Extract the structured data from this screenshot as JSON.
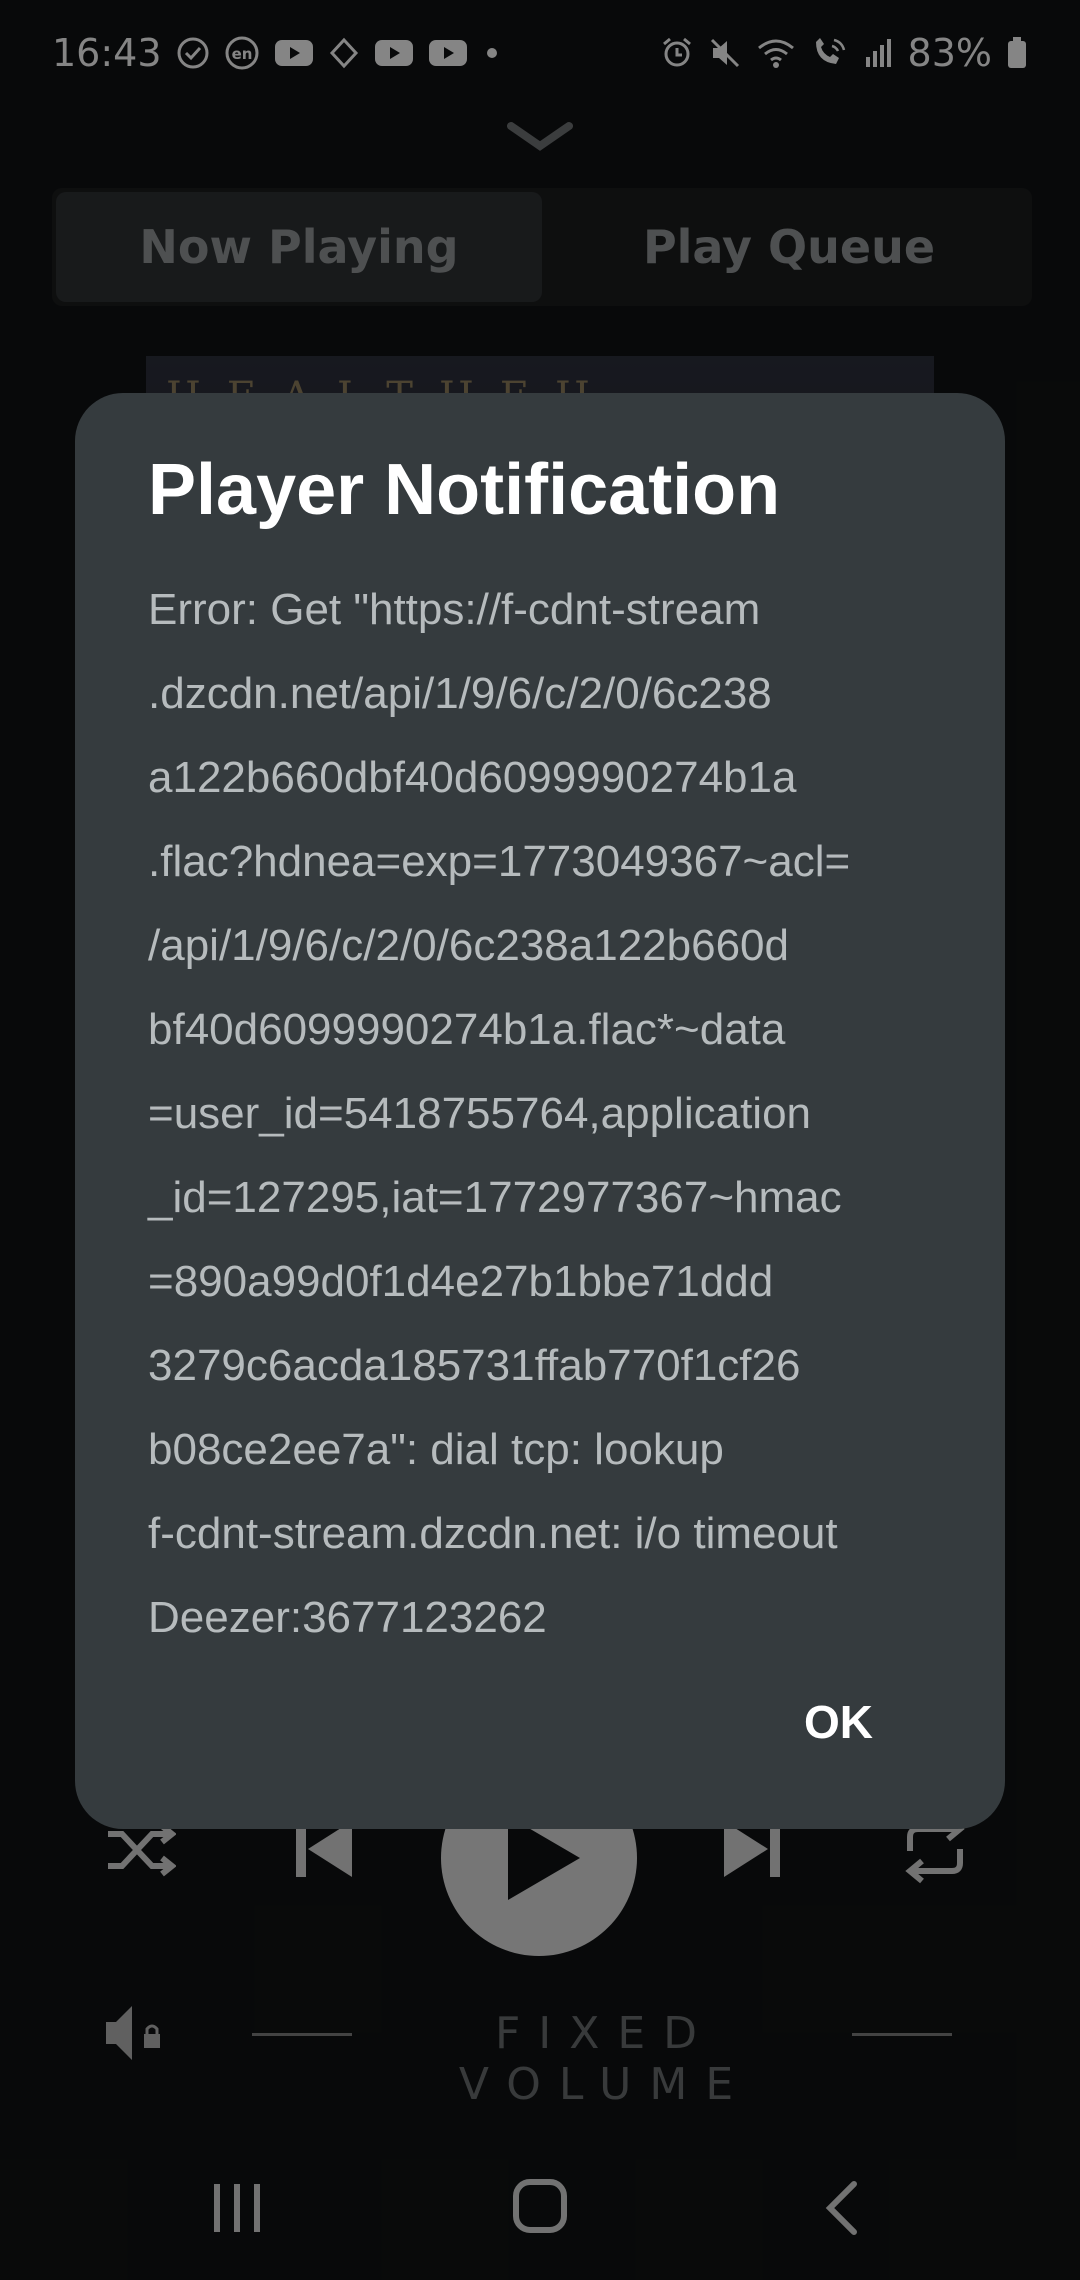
{
  "status_bar": {
    "time": "16:43",
    "battery": "83%",
    "left_icons": [
      "check-circle-icon",
      "en-badge-icon",
      "youtube-icon",
      "diamond-icon",
      "youtube-icon",
      "youtube-icon",
      "dot-icon"
    ],
    "right_icons": [
      "alarm-icon",
      "mute-icon",
      "wifi-icon",
      "wifi-calling-icon",
      "signal-icon",
      "battery-icon"
    ]
  },
  "player": {
    "tabs": [
      {
        "label": "Now Playing",
        "active": true
      },
      {
        "label": "Play Queue",
        "active": false
      }
    ],
    "album_art_text": "HEALTHEH",
    "fixed_volume_label": "FIXED VOLUME",
    "controls": [
      "shuffle-icon",
      "previous-icon",
      "play-icon",
      "next-icon",
      "repeat-icon"
    ]
  },
  "dialog": {
    "title": "Player Notification",
    "lines": [
      "Error: Get \"https://f-cdnt-stream",
      ".dzcdn.net/api/1/9/6/c/2/0/6c238",
      "a122b660dbf40d6099990274b1a",
      ".flac?hdnea=exp=1773049367~acl=",
      "/api/1/9/6/c/2/0/6c238a122b660d",
      "bf40d6099990274b1a.flac*~data",
      "=user_id=5418755764,application",
      "_id=127295,iat=1772977367~hmac",
      "=890a99d0f1d4e27b1bbe71ddd",
      "3279c6acda185731ffab770f1cf26",
      "b08ce2ee7a\": dial tcp: lookup",
      "f-cdnt-stream.dzcdn.net: i/o timeout",
      "Deezer:3677123262"
    ],
    "ok_label": "OK"
  },
  "navbar": [
    "recent-apps-icon",
    "home-icon",
    "back-icon"
  ]
}
